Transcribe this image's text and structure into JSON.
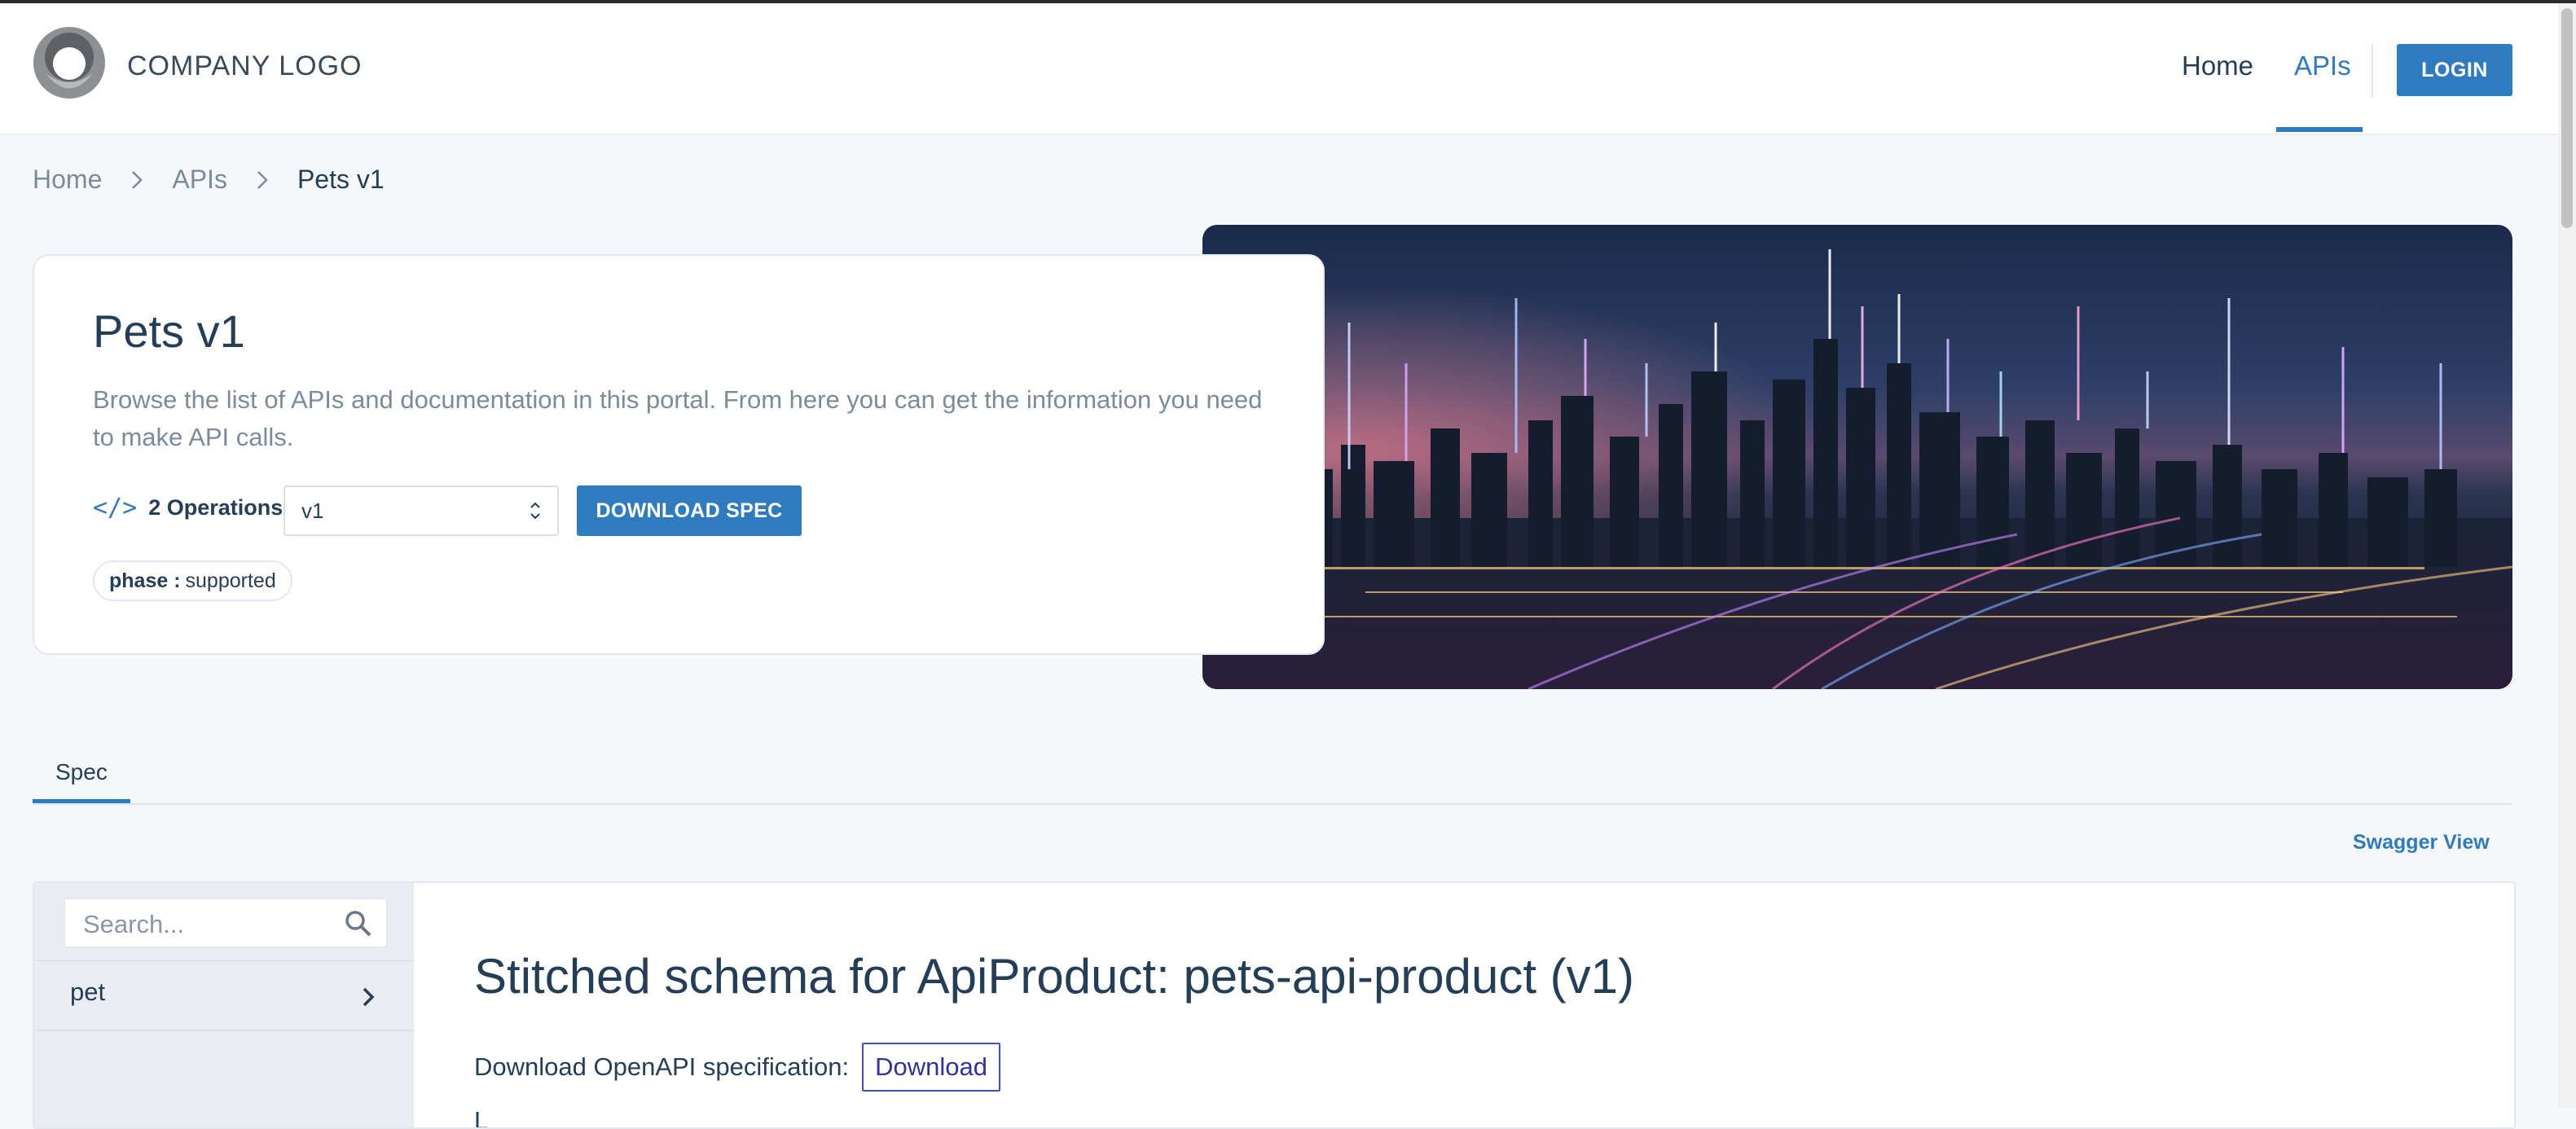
{
  "header": {
    "logo_text": "COMPANY LOGO",
    "nav": {
      "home": "Home",
      "apis": "APIs"
    },
    "login_label": "LOGIN",
    "accent_color": "#2f7bbf"
  },
  "breadcrumb": {
    "items": [
      "Home",
      "APIs",
      "Pets v1"
    ]
  },
  "api_card": {
    "title": "Pets v1",
    "description": "Browse the list of APIs and documentation in this portal. From here you can get the information you need to make API calls.",
    "operations": "2 Operations",
    "operations_icon": "</>",
    "version_selected": "v1",
    "download_spec_label": "DOWNLOAD SPEC",
    "phase_key": "phase :",
    "phase_value": "supported"
  },
  "hero_image": {
    "description_icon": "city-skyline-image"
  },
  "tabs": {
    "spec": "Spec"
  },
  "swagger_view": "Swagger View",
  "docs": {
    "search_placeholder": "Search...",
    "sidebar_items": [
      {
        "label": "pet"
      }
    ],
    "heading": "Stitched schema for ApiProduct: pets-api-product (v1)",
    "download_label": "Download OpenAPI specification:",
    "download_button": "Download",
    "cut_off_text": "L"
  }
}
